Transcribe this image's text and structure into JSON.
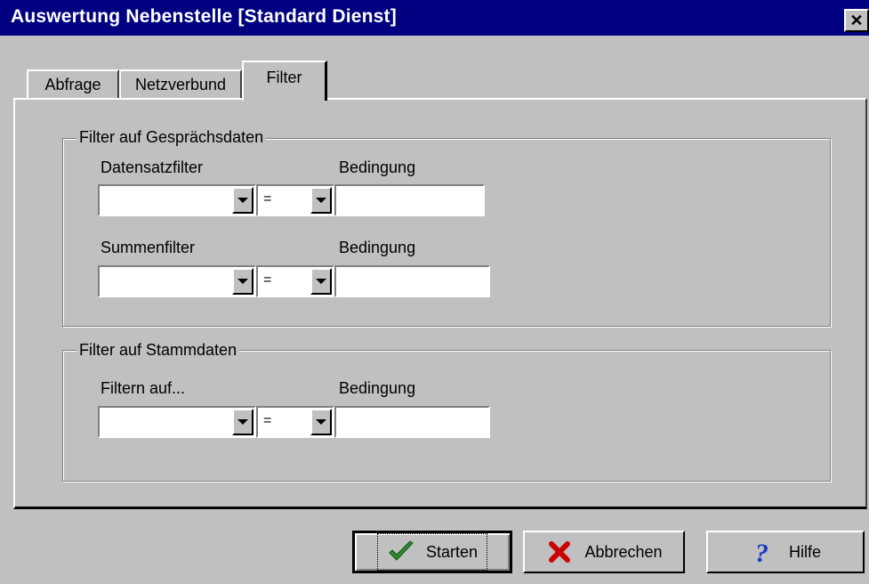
{
  "window": {
    "title": "Auswertung Nebenstelle [Standard Dienst]",
    "close_glyph": "✕"
  },
  "tabs": [
    {
      "label": "Abfrage"
    },
    {
      "label": "Netzverbund"
    },
    {
      "label": "Filter"
    }
  ],
  "groups": {
    "gespraechsdaten": {
      "title": "Filter auf Gesprächsdaten",
      "datensatzfilter": {
        "label": "Datensatzfilter",
        "value": "",
        "operator": "=",
        "condition_label": "Bedingung",
        "condition_value": ""
      },
      "summenfilter": {
        "label": "Summenfilter",
        "value": "",
        "operator": "=",
        "condition_label": "Bedingung",
        "condition_value": ""
      }
    },
    "stammdaten": {
      "title": "Filter auf Stammdaten",
      "filtern_auf": {
        "label": "Filtern auf...",
        "value": "",
        "operator": "=",
        "condition_label": "Bedingung",
        "condition_value": ""
      }
    }
  },
  "buttons": {
    "start": {
      "label": "Starten",
      "icon": "checkmark-icon",
      "color": "#2e8b2e"
    },
    "cancel": {
      "label": "Abbrechen",
      "icon": "red-x-icon",
      "color": "#cc0000"
    },
    "help": {
      "label": "Hilfe",
      "icon": "question-mark-icon",
      "color": "#1a3cc8"
    }
  },
  "colors": {
    "titlebar": "#000080",
    "face": "#c0c0c0"
  }
}
